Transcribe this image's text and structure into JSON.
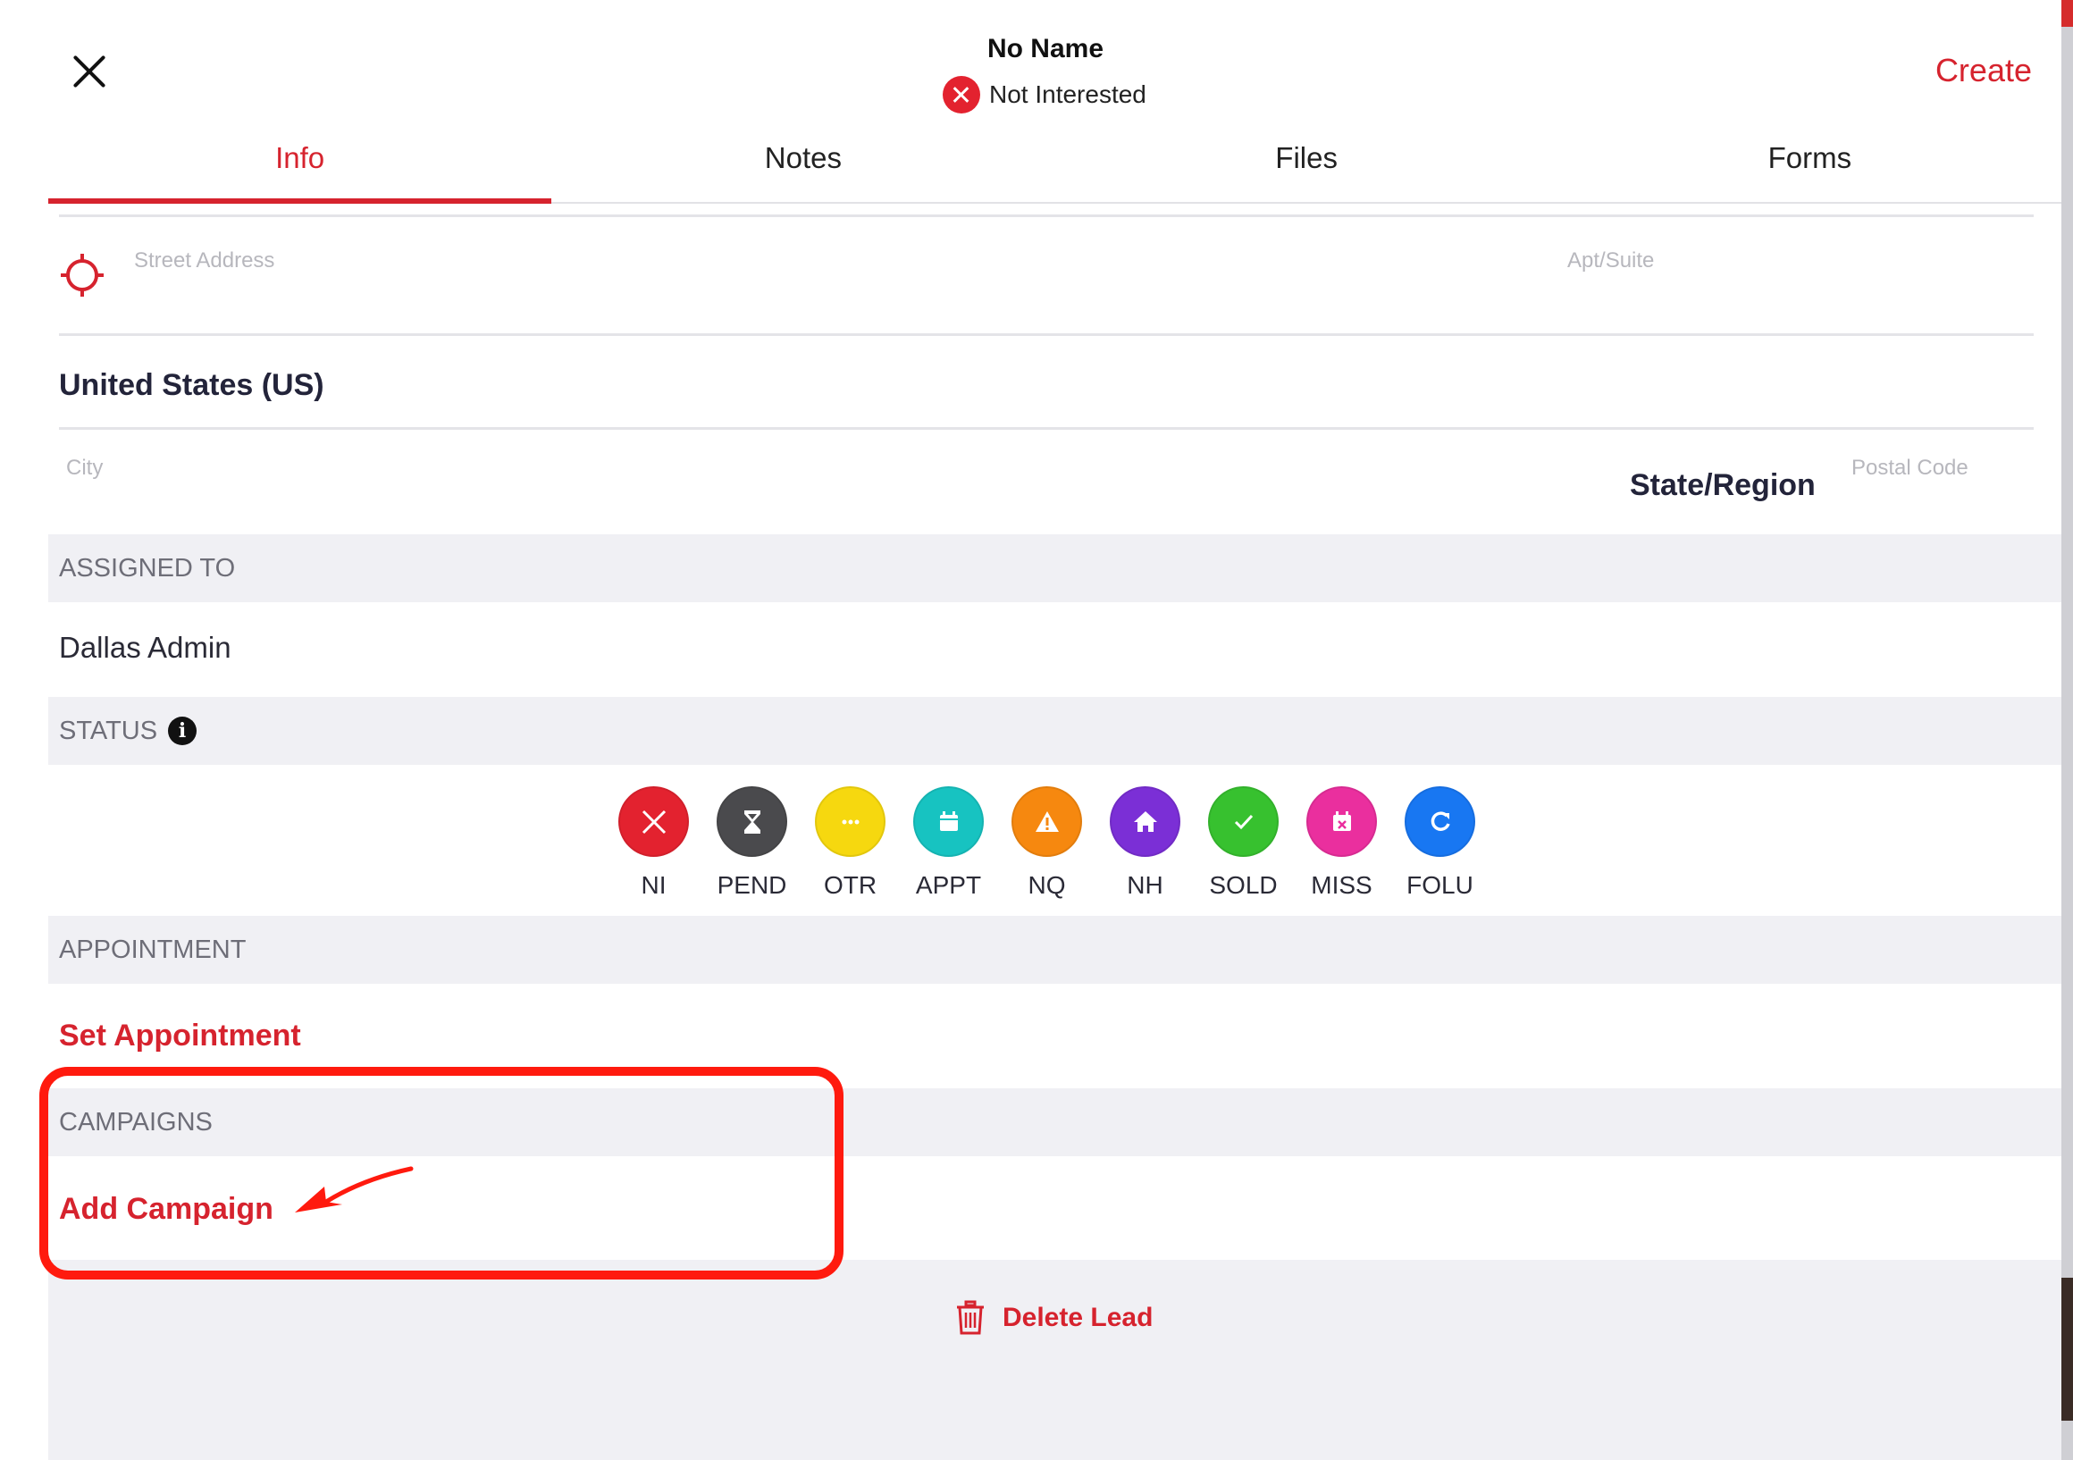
{
  "header": {
    "close_icon": "close-icon",
    "lead_name": "No Name",
    "lead_status": "Not Interested",
    "lead_status_icon": "x-circle-icon",
    "create_label": "Create"
  },
  "tabs": [
    {
      "label": "Info",
      "active": true
    },
    {
      "label": "Notes",
      "active": false
    },
    {
      "label": "Files",
      "active": false
    },
    {
      "label": "Forms",
      "active": false
    }
  ],
  "address": {
    "location_icon": "crosshair-icon",
    "street_placeholder": "Street Address",
    "apt_placeholder": "Apt/Suite",
    "country": "United States (US)",
    "city_placeholder": "City",
    "state_label": "State/Region",
    "postal_placeholder": "Postal Code"
  },
  "assigned": {
    "header": "ASSIGNED TO",
    "value": "Dallas Admin"
  },
  "status": {
    "header": "STATUS",
    "info_icon": "info-icon",
    "options": [
      {
        "label": "NI",
        "color": "#e3222f",
        "icon": "x-icon"
      },
      {
        "label": "PEND",
        "color": "#4a4a4d",
        "icon": "hourglass-icon"
      },
      {
        "label": "OTR",
        "color": "#f6d80f",
        "icon": "ellipsis-icon"
      },
      {
        "label": "APPT",
        "color": "#17c3c1",
        "icon": "calendar-icon"
      },
      {
        "label": "NQ",
        "color": "#f6880f",
        "icon": "warning-icon"
      },
      {
        "label": "NH",
        "color": "#7b2fd6",
        "icon": "home-icon"
      },
      {
        "label": "SOLD",
        "color": "#37c12f",
        "icon": "check-icon"
      },
      {
        "label": "MISS",
        "color": "#ea2f9e",
        "icon": "calendar-x-icon"
      },
      {
        "label": "FOLU",
        "color": "#1877f2",
        "icon": "refresh-icon"
      }
    ]
  },
  "appointment": {
    "header": "APPOINTMENT",
    "action": "Set Appointment"
  },
  "campaigns": {
    "header": "CAMPAIGNS",
    "action": "Add Campaign"
  },
  "footer": {
    "delete_label": "Delete Lead",
    "delete_icon": "trash-icon"
  },
  "annotation_color": "#ff1a0e",
  "accent_color": "#d6232e"
}
